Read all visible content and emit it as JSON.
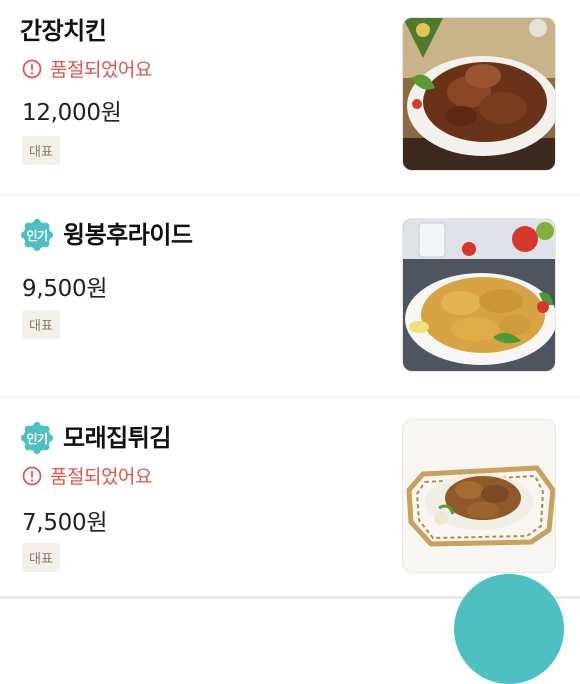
{
  "menu": {
    "items": [
      {
        "name": "간장치킨",
        "status": "품절되었어요",
        "price": "12,000원",
        "tag": "대표",
        "popular_badge": null,
        "image": "soy-garlic-fried-chicken-plate"
      },
      {
        "name": "윙봉후라이드",
        "status": null,
        "price": "9,500원",
        "tag": "대표",
        "popular_badge": "인기",
        "image": "fried-chicken-wings-plate"
      },
      {
        "name": "모래집튀김",
        "status": "품절되었어요",
        "price": "7,500원",
        "tag": "대표",
        "popular_badge": "인기",
        "image": "fried-gizzards-basket"
      }
    ]
  },
  "colors": {
    "soldout": "#e0564a",
    "badge": "#4fc0c2",
    "tag_bg": "#f3efe9",
    "tag_text": "#8a7a6a"
  },
  "icons": {
    "soldout": "alert-circle-icon",
    "popular": "scalloped-badge-icon"
  }
}
